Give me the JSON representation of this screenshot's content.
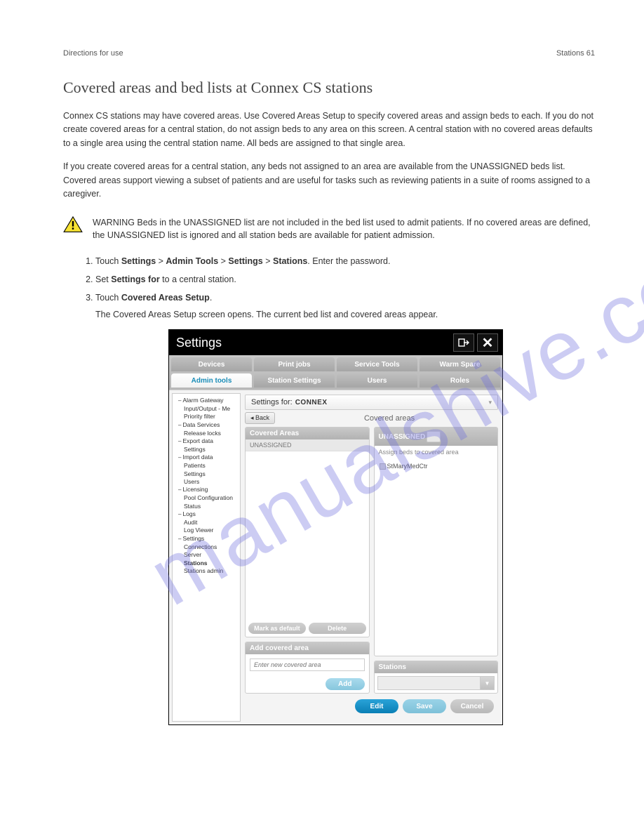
{
  "page_header": {
    "left": "Directions for use",
    "right": "Stations   61"
  },
  "heading": "Covered areas and bed lists at Connex CS stations",
  "paragraphs": {
    "p1": "Connex CS stations may have covered areas. Use Covered Areas Setup to specify covered areas and assign beds to each. If you do not create covered areas for a central station, do not assign beds to any area on this screen. A central station with no covered areas defaults to a single area using the central station name. All beds are assigned to that single area.",
    "p2": "If you create covered areas for a central station, any beds not assigned to an area are available from the UNASSIGNED beds list. Covered areas support viewing a subset of patients and are useful for tasks such as reviewing patients in a suite of rooms assigned to a caregiver."
  },
  "warning_text": "WARNING   Beds in the UNASSIGNED list are not included in the bed list used to admit patients. If no covered areas are defined, the UNASSIGNED list is ignored and all station beds are available for patient admission.",
  "steps": {
    "s1": {
      "pre": "Touch ",
      "b1": "Settings",
      "mid": " > ",
      "b2": "Admin Tools",
      "mid2": " > ",
      "b3": "Settings",
      "mid3": " > ",
      "b4": "Stations",
      "post": ". Enter the password."
    },
    "s2a": "Set ",
    "s2b": "Settings for",
    "s2c": " to a central station.",
    "s3a": "Touch ",
    "s3b": "Covered Areas Setup",
    "s3c": "."
  },
  "post_text": "The Covered Areas Setup screen opens. The current bed list and covered areas appear.",
  "ui": {
    "title": "Settings",
    "tabs_row1": [
      "Devices",
      "Print jobs",
      "Service Tools",
      "Warm Spare"
    ],
    "tabs_row2": [
      "Admin tools",
      "Station Settings",
      "Users",
      "Roles"
    ],
    "active_tab": "Admin tools",
    "tree": [
      {
        "txt": "Alarm Gateway",
        "lvl": 0,
        "c": true
      },
      {
        "txt": "Input/Output - Me",
        "lvl": 2
      },
      {
        "txt": "Priority filter",
        "lvl": 2
      },
      {
        "txt": "Data Services",
        "lvl": 0,
        "c": true
      },
      {
        "txt": "Release locks",
        "lvl": 2
      },
      {
        "txt": "Export data",
        "lvl": 0,
        "c": true
      },
      {
        "txt": "Settings",
        "lvl": 2
      },
      {
        "txt": "Import data",
        "lvl": 0,
        "c": true
      },
      {
        "txt": "Patients",
        "lvl": 2
      },
      {
        "txt": "Settings",
        "lvl": 2
      },
      {
        "txt": "Users",
        "lvl": 2
      },
      {
        "txt": "Licensing",
        "lvl": 0,
        "c": true
      },
      {
        "txt": "Pool Configuration",
        "lvl": 2
      },
      {
        "txt": "Status",
        "lvl": 2
      },
      {
        "txt": "Logs",
        "lvl": 0,
        "c": true
      },
      {
        "txt": "Audit",
        "lvl": 2
      },
      {
        "txt": "Log Viewer",
        "lvl": 2
      },
      {
        "txt": "Settings",
        "lvl": 0,
        "c": true
      },
      {
        "txt": "Connections",
        "lvl": 2
      },
      {
        "txt": "Server",
        "lvl": 2
      },
      {
        "txt": "Stations",
        "lvl": 2,
        "bold": true
      },
      {
        "txt": "Stations admin",
        "lvl": 2
      }
    ],
    "settings_for_label": "Settings for:",
    "settings_for_value": "CONNEX",
    "back": "Back",
    "section": "Covered areas",
    "panels": {
      "covered": "Covered Areas",
      "covered_item": "UNASSIGNED",
      "mark_default": "Mark as default",
      "delete": "Delete",
      "unassigned": "UNASSIGNED",
      "assign_label": "Assign beds to covered area",
      "tree_item": "StMaryMedCtr",
      "add_area": "Add covered area",
      "add_placeholder": "Enter new covered area",
      "add_btn": "Add",
      "stations": "Stations"
    },
    "actions": {
      "edit": "Edit",
      "save": "Save",
      "cancel": "Cancel"
    }
  }
}
